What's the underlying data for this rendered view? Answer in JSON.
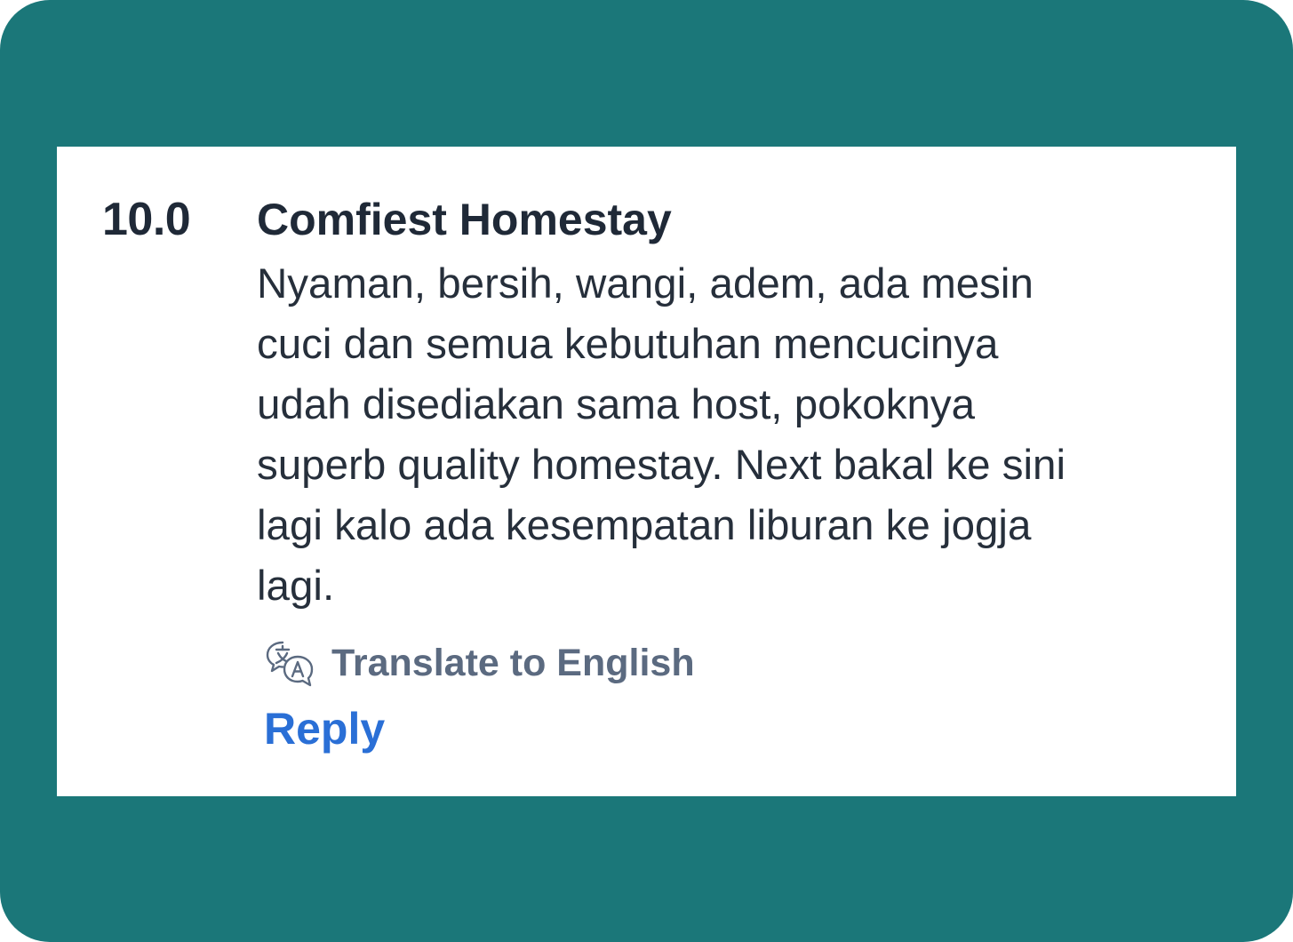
{
  "review": {
    "score": "10.0",
    "title": "Comfiest Homestay",
    "lines": [
      "Nyaman, bersih, wangi, adem, ada mesin",
      "cuci dan semua kebutuhan mencucinya",
      "udah disediakan sama host, pokoknya",
      "superb quality homestay. Next bakal ke sini",
      "lagi kalo ada kesempatan liburan ke jogja",
      "lagi."
    ],
    "translate_label": "Translate to English",
    "translate_icon": "translate-icon",
    "reply_label": "Reply"
  },
  "colors": {
    "frame_background": "#1b7779",
    "card_background": "#ffffff",
    "text_primary": "#1f2937",
    "translate_text": "#5b6a80",
    "link_blue": "#2a6fd6"
  }
}
